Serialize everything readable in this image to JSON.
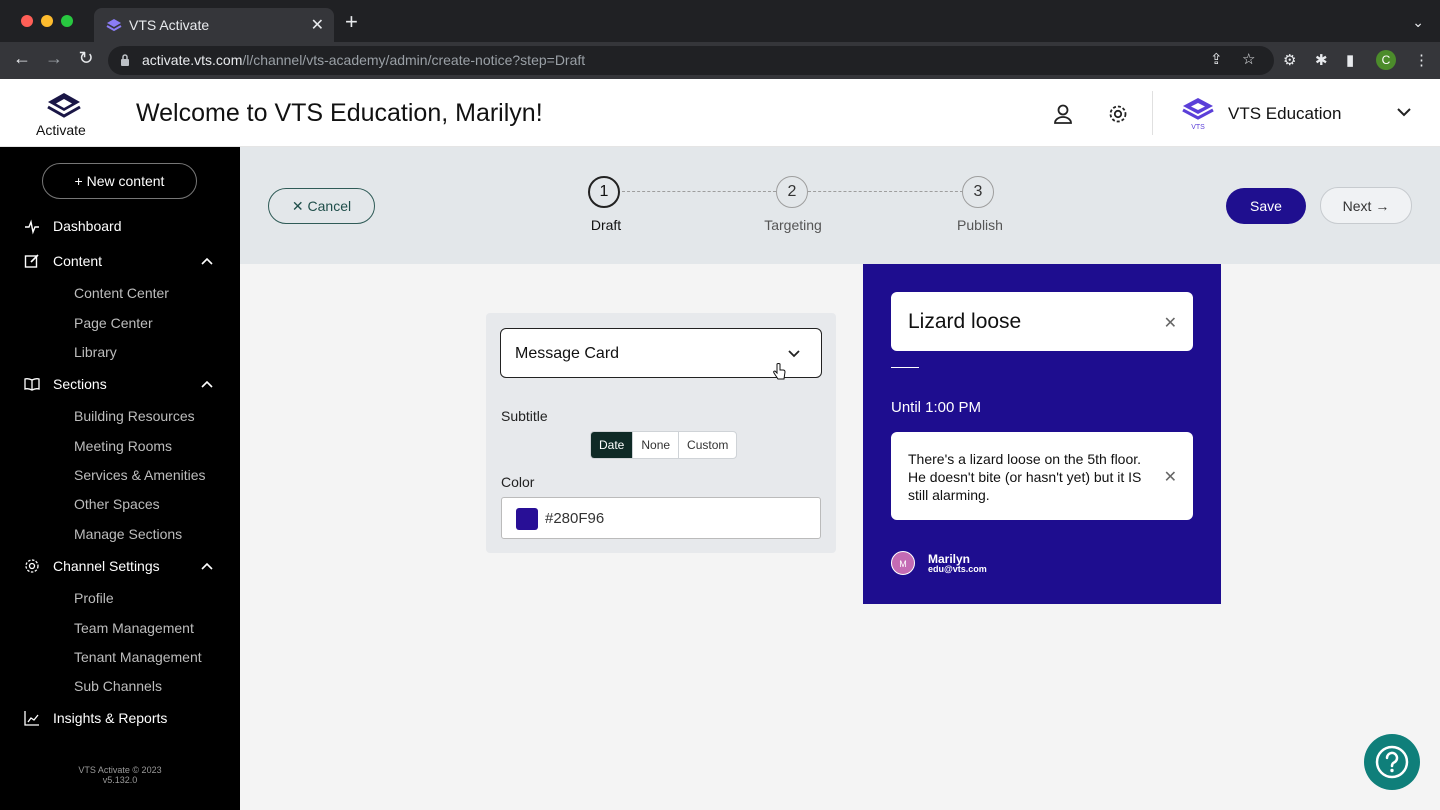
{
  "browser": {
    "tab_title": "VTS Activate",
    "tab_close": "✕",
    "new_tab": "+",
    "tab_menu": "⌄",
    "url_host": "activate.vts.com",
    "url_path": "/l/channel/vts-academy/admin/create-notice?step=Draft",
    "profile_initial": "C"
  },
  "header": {
    "logo_text": "Activate",
    "welcome": "Welcome to VTS Education, Marilyn!",
    "org_name": "VTS Education"
  },
  "sidebar": {
    "new_content": "+ New content",
    "dashboard": "Dashboard",
    "content": {
      "label": "Content",
      "items": [
        "Content Center",
        "Page Center",
        "Library"
      ]
    },
    "sections": {
      "label": "Sections",
      "items": [
        "Building Resources",
        "Meeting Rooms",
        "Services & Amenities",
        "Other Spaces",
        "Manage Sections"
      ]
    },
    "channel_settings": {
      "label": "Channel Settings",
      "items": [
        "Profile",
        "Team Management",
        "Tenant Management",
        "Sub Channels"
      ]
    },
    "insights": "Insights & Reports",
    "footer_line1": "VTS Activate © 2023",
    "footer_line2": "v5.132.0"
  },
  "stepbar": {
    "cancel": "✕  Cancel",
    "steps": [
      {
        "number": "1",
        "label": "Draft"
      },
      {
        "number": "2",
        "label": "Targeting"
      },
      {
        "number": "3",
        "label": "Publish"
      }
    ],
    "save": "Save",
    "next": "Next →"
  },
  "editor": {
    "type_value": "Message Card",
    "subtitle_label": "Subtitle",
    "subtitle_options": [
      "Date",
      "None",
      "Custom"
    ],
    "subtitle_selected": "Date",
    "color_label": "Color",
    "color_value": "#280F96"
  },
  "preview": {
    "title": "Lizard loose",
    "until": "Until 1:00 PM",
    "body": "There's a lizard loose on the 5th floor. He doesn't bite (or hasn't yet) but it IS still alarming.",
    "close_glyph": "✕",
    "author_initial": "M",
    "author_name": "Marilyn",
    "author_email": "edu@vts.com"
  },
  "colors": {
    "brand": "#1F0F8F",
    "card_color": "#280F96",
    "help": "#0F7F7A"
  }
}
